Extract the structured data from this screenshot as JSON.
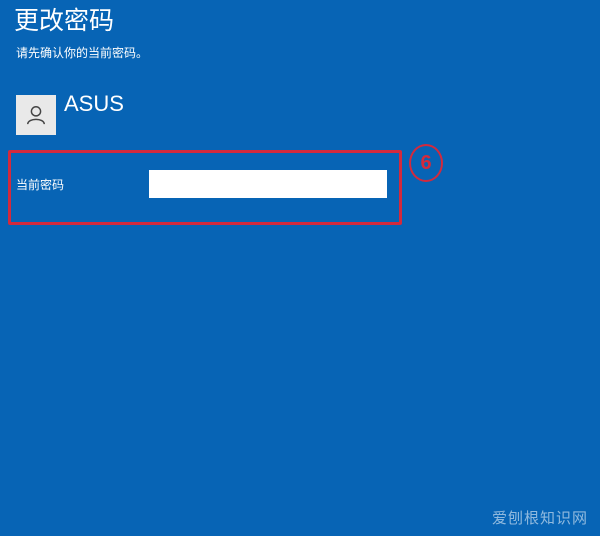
{
  "page": {
    "title": "更改密码",
    "subtitle": "请先确认你的当前密码。"
  },
  "account": {
    "username": "ASUS",
    "avatar_icon": "user-icon"
  },
  "form": {
    "current_password_label": "当前密码",
    "current_password_value": ""
  },
  "annotation": {
    "step_number": "6",
    "color": "#d32a3d"
  },
  "watermark": "爱刨根知识网",
  "colors": {
    "background": "#0764b5",
    "avatar_bg": "#e9e9e9"
  }
}
